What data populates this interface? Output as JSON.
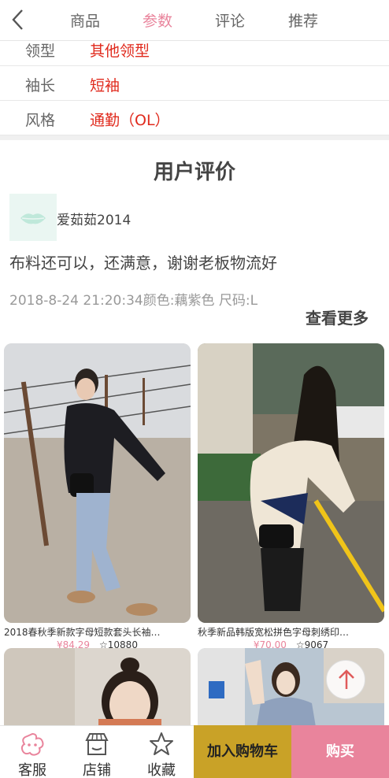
{
  "nav": {
    "tabs": [
      {
        "label": "商品",
        "active": false
      },
      {
        "label": "参数",
        "active": true
      },
      {
        "label": "评论",
        "active": false
      },
      {
        "label": "推荐",
        "active": false
      }
    ]
  },
  "params": [
    {
      "key": "领型",
      "value": "其他领型"
    },
    {
      "key": "袖长",
      "value": "短袖"
    },
    {
      "key": "风格",
      "value": "通勤（OL）"
    }
  ],
  "reviews": {
    "title": "用户评价",
    "user": "爱茹茹2014",
    "text": "布料还可以，还满意，谢谢老板物流好",
    "meta": "2018-8-24 21:20:34颜色:藕紫色 尺码:L",
    "more": "查看更多"
  },
  "products": [
    {
      "name": "2018春秋季新款字母短款套头长袖…",
      "price": "¥84.29",
      "favs": "10880"
    },
    {
      "name": "秋季新品韩版宽松拼色字母刺绣印…",
      "price": "¥70.00",
      "favs": "9067"
    }
  ],
  "bottom": {
    "service": "客服",
    "store": "店铺",
    "collect": "收藏",
    "cart": "加入购物车",
    "buy": "购买"
  },
  "colors": {
    "accent": "#e9849c",
    "param_value": "#e02a1d",
    "cart_button": "#c9a227"
  }
}
